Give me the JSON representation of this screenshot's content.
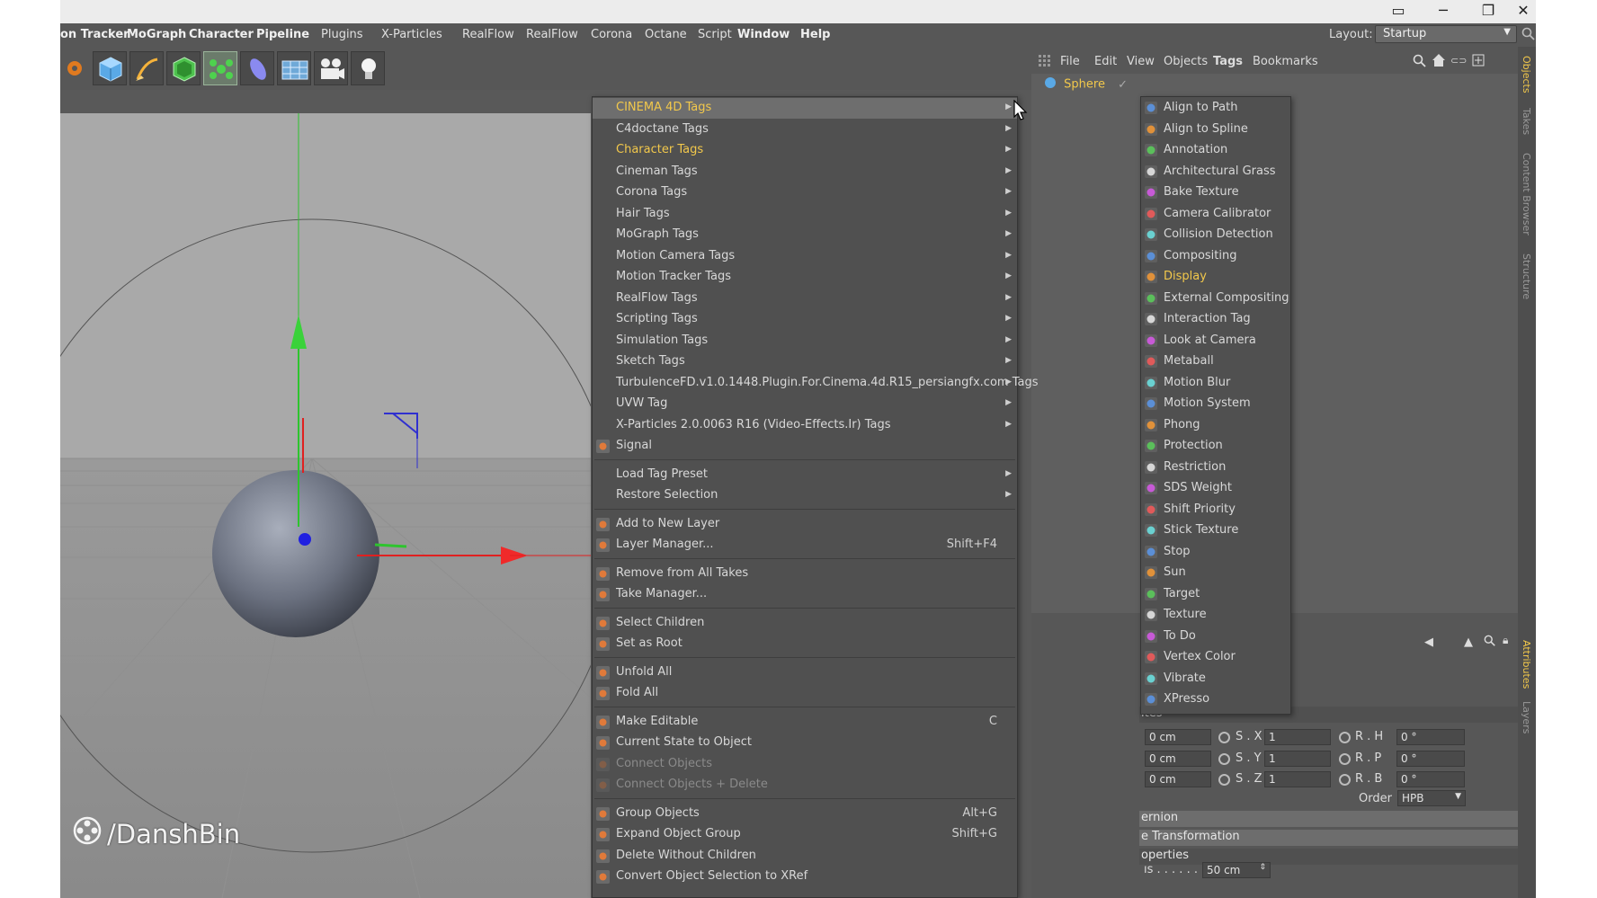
{
  "window": {
    "controls": {
      "minimize": "─",
      "maximize": "❐",
      "close": "✕",
      "extra": "▭"
    }
  },
  "menubar": {
    "items": [
      {
        "label": "on Tracker",
        "bold": true
      },
      {
        "label": "MoGraph",
        "bold": true
      },
      {
        "label": "Character",
        "bold": true
      },
      {
        "label": "Pipeline",
        "bold": true
      },
      {
        "label": "Plugins",
        "bold": false
      },
      {
        "label": "X-Particles",
        "bold": false
      },
      {
        "label": "RealFlow",
        "bold": false
      },
      {
        "label": "RealFlow",
        "bold": false
      },
      {
        "label": "Corona",
        "bold": false
      },
      {
        "label": "Octane",
        "bold": false
      },
      {
        "label": "Script",
        "bold": false
      },
      {
        "label": "Window",
        "bold": true
      },
      {
        "label": "Help",
        "bold": true
      }
    ],
    "layout_label": "Layout:",
    "layout_value": "Startup"
  },
  "toolbar": {
    "icons": [
      "settings-gear-icon",
      "cube-icon",
      "pen-icon",
      "subdivision-icon",
      "mograph-cloner-icon",
      "deformer-icon",
      "scene-grid-icon",
      "camera-icon",
      "light-icon"
    ]
  },
  "viewport": {
    "watermark": "/DanshBin"
  },
  "context_menu": {
    "items": [
      {
        "label": "CINEMA 4D Tags",
        "submenu": true,
        "highlight": true,
        "yellow": true
      },
      {
        "label": "C4doctane Tags",
        "submenu": true
      },
      {
        "label": "Character Tags",
        "submenu": true,
        "yellow": true
      },
      {
        "label": "Cineman Tags",
        "submenu": true
      },
      {
        "label": "Corona Tags",
        "submenu": true
      },
      {
        "label": "Hair Tags",
        "submenu": true
      },
      {
        "label": "MoGraph Tags",
        "submenu": true
      },
      {
        "label": "Motion Camera Tags",
        "submenu": true
      },
      {
        "label": "Motion Tracker Tags",
        "submenu": true
      },
      {
        "label": "RealFlow Tags",
        "submenu": true
      },
      {
        "label": "Scripting Tags",
        "submenu": true
      },
      {
        "label": "Simulation Tags",
        "submenu": true
      },
      {
        "label": "Sketch Tags",
        "submenu": true
      },
      {
        "label": "TurbulenceFD.v1.0.1448.Plugin.For.Cinema.4d.R15_persiangfx.com Tags",
        "submenu": true
      },
      {
        "label": "UVW Tag",
        "submenu": true
      },
      {
        "label": "X-Particles 2.0.0063 R16 (Video-Effects.Ir) Tags",
        "submenu": true
      },
      {
        "label": "Signal",
        "icon": "signal-icon"
      },
      {
        "sep": true
      },
      {
        "label": "Load Tag Preset",
        "submenu": true
      },
      {
        "label": "Restore Selection",
        "submenu": true
      },
      {
        "sep": true
      },
      {
        "label": "Add to New Layer",
        "icon": "layer-add-icon"
      },
      {
        "label": "Layer Manager...",
        "icon": "layer-manager-icon",
        "shortcut": "Shift+F4"
      },
      {
        "sep": true
      },
      {
        "label": "Remove from All Takes",
        "icon": "take-remove-icon"
      },
      {
        "label": "Take Manager...",
        "icon": "take-manager-icon"
      },
      {
        "sep": true
      },
      {
        "label": "Select Children",
        "icon": "select-children-icon"
      },
      {
        "label": "Set as Root",
        "icon": "set-root-icon"
      },
      {
        "sep": true
      },
      {
        "label": "Unfold All",
        "icon": "unfold-icon"
      },
      {
        "label": "Fold All",
        "icon": "fold-icon"
      },
      {
        "sep": true
      },
      {
        "label": "Make Editable",
        "icon": "make-editable-icon",
        "shortcut": "C"
      },
      {
        "label": "Current State to Object",
        "icon": "current-state-icon"
      },
      {
        "label": "Connect Objects",
        "icon": "connect-icon",
        "disabled": true
      },
      {
        "label": "Connect Objects + Delete",
        "icon": "connect-delete-icon",
        "disabled": true
      },
      {
        "sep": true
      },
      {
        "label": "Group Objects",
        "icon": "group-icon",
        "shortcut": "Alt+G"
      },
      {
        "label": "Expand Object Group",
        "icon": "expand-group-icon",
        "shortcut": "Shift+G"
      },
      {
        "label": "Delete Without Children",
        "icon": "delete-icon"
      },
      {
        "label": "Convert Object Selection to XRef",
        "icon": "xref-icon"
      }
    ]
  },
  "submenu": {
    "items": [
      {
        "label": "Align to Path",
        "icon": "align-path-icon"
      },
      {
        "label": "Align to Spline",
        "icon": "align-spline-icon"
      },
      {
        "label": "Annotation",
        "icon": "annotation-icon"
      },
      {
        "label": "Architectural Grass",
        "icon": "grass-icon"
      },
      {
        "label": "Bake Texture",
        "icon": "bake-icon"
      },
      {
        "label": "Camera Calibrator",
        "icon": "calibrator-icon"
      },
      {
        "label": "Collision Detection",
        "icon": "collision-icon"
      },
      {
        "label": "Compositing",
        "icon": "compositing-icon"
      },
      {
        "label": "Display",
        "icon": "display-icon",
        "yellow": true
      },
      {
        "label": "External Compositing",
        "icon": "ext-compositing-icon"
      },
      {
        "label": "Interaction Tag",
        "icon": "interaction-icon"
      },
      {
        "label": "Look at Camera",
        "icon": "look-camera-icon"
      },
      {
        "label": "Metaball",
        "icon": "metaball-icon"
      },
      {
        "label": "Motion Blur",
        "icon": "motion-blur-icon"
      },
      {
        "label": "Motion System",
        "icon": "motion-system-icon"
      },
      {
        "label": "Phong",
        "icon": "phong-icon"
      },
      {
        "label": "Protection",
        "icon": "protection-icon"
      },
      {
        "label": "Restriction",
        "icon": "restriction-icon"
      },
      {
        "label": "SDS Weight",
        "icon": "sds-weight-icon"
      },
      {
        "label": "Shift Priority",
        "icon": "shift-priority-icon"
      },
      {
        "label": "Stick Texture",
        "icon": "stick-texture-icon"
      },
      {
        "label": "Stop",
        "icon": "stop-icon"
      },
      {
        "label": "Sun",
        "icon": "sun-icon"
      },
      {
        "label": "Target",
        "icon": "target-icon"
      },
      {
        "label": "Texture",
        "icon": "texture-icon"
      },
      {
        "label": "To Do",
        "icon": "todo-icon"
      },
      {
        "label": "Vertex Color",
        "icon": "vertex-color-icon"
      },
      {
        "label": "Vibrate",
        "icon": "vibrate-icon"
      },
      {
        "label": "XPresso",
        "icon": "xpresso-icon"
      }
    ]
  },
  "object_manager": {
    "menus": [
      "File",
      "Edit",
      "View",
      "Objects",
      "Tags",
      "Bookmarks"
    ],
    "object_name": "Sphere"
  },
  "right_tabs": [
    "Objects",
    "Takes",
    "Content Browser",
    "Structure",
    "Attributes",
    "Layers"
  ],
  "attribute_manager": {
    "header": "ites",
    "pos": [
      "0 cm",
      "0 cm",
      "0 cm"
    ],
    "scale_labels": [
      "S . X",
      "S . Y",
      "S . Z"
    ],
    "scale": [
      "1",
      "1",
      "1"
    ],
    "rot_labels": [
      "R . H",
      "R . P",
      "R . B"
    ],
    "rot": [
      "0 °",
      "0 °",
      "0 °"
    ],
    "order_label": "Order",
    "order_value": "HPB",
    "bars": [
      "ernion",
      "e Transformation",
      "operties"
    ],
    "radius_label": "ıs . . . . . .",
    "radius_value": "50 cm"
  },
  "colors": {
    "accent_yellow": "#f2c84b",
    "axis_red": "#e02020",
    "axis_green": "#2ec42e",
    "axis_blue": "#3030d0"
  }
}
